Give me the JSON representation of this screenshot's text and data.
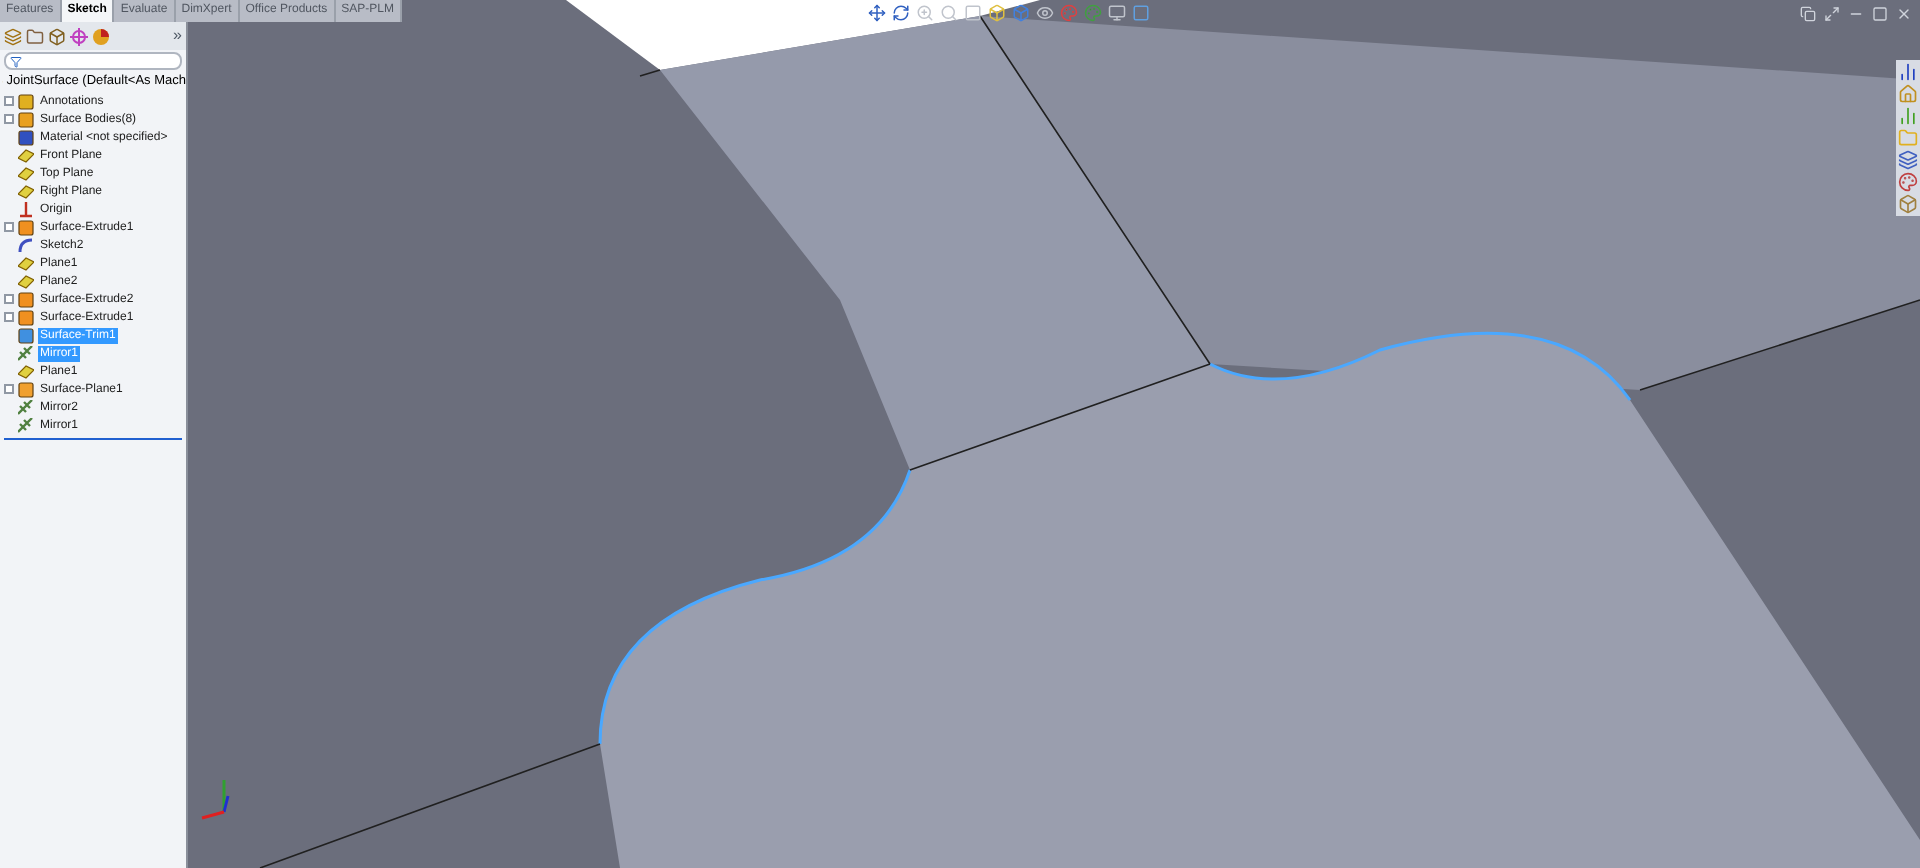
{
  "tabs": [
    {
      "label": "Features",
      "selected": false
    },
    {
      "label": "Sketch",
      "selected": true
    },
    {
      "label": "Evaluate",
      "selected": false
    },
    {
      "label": "DimXpert",
      "selected": false
    },
    {
      "label": "Office Products",
      "selected": false
    },
    {
      "label": "SAP-PLM",
      "selected": false
    }
  ],
  "panel": {
    "more": "»",
    "root": "JointSurface  (Default<As Mach"
  },
  "tree": [
    {
      "label": "Annotations",
      "kind": "annotations",
      "expandable": true,
      "selected": false
    },
    {
      "label": "Surface Bodies(8)",
      "kind": "bodies",
      "expandable": true,
      "selected": false
    },
    {
      "label": "Material <not specified>",
      "kind": "material",
      "expandable": false,
      "selected": false
    },
    {
      "label": "Front Plane",
      "kind": "plane",
      "expandable": false,
      "selected": false
    },
    {
      "label": "Top Plane",
      "kind": "plane",
      "expandable": false,
      "selected": false
    },
    {
      "label": "Right Plane",
      "kind": "plane",
      "expandable": false,
      "selected": false
    },
    {
      "label": "Origin",
      "kind": "origin",
      "expandable": false,
      "selected": false
    },
    {
      "label": "Surface-Extrude1",
      "kind": "extrude",
      "expandable": true,
      "selected": false
    },
    {
      "label": "Sketch2",
      "kind": "sketch",
      "expandable": false,
      "selected": false
    },
    {
      "label": "Plane1",
      "kind": "plane",
      "expandable": false,
      "selected": false
    },
    {
      "label": "Plane2",
      "kind": "plane",
      "expandable": false,
      "selected": false
    },
    {
      "label": "Surface-Extrude2",
      "kind": "extrude",
      "expandable": true,
      "selected": false
    },
    {
      "label": "Surface-Extrude1",
      "kind": "extrude",
      "expandable": true,
      "selected": false
    },
    {
      "label": "Surface-Trim1",
      "kind": "trim",
      "expandable": false,
      "selected": true
    },
    {
      "label": "Mirror1",
      "kind": "mirror",
      "expandable": false,
      "selected": true
    },
    {
      "label": "Plane1",
      "kind": "plane",
      "expandable": false,
      "selected": false
    },
    {
      "label": "Surface-Plane1",
      "kind": "surfplane",
      "expandable": true,
      "selected": false
    },
    {
      "label": "Mirror2",
      "kind": "mirror",
      "expandable": false,
      "selected": false
    },
    {
      "label": "Mirror1",
      "kind": "mirror",
      "expandable": false,
      "selected": false
    }
  ]
}
